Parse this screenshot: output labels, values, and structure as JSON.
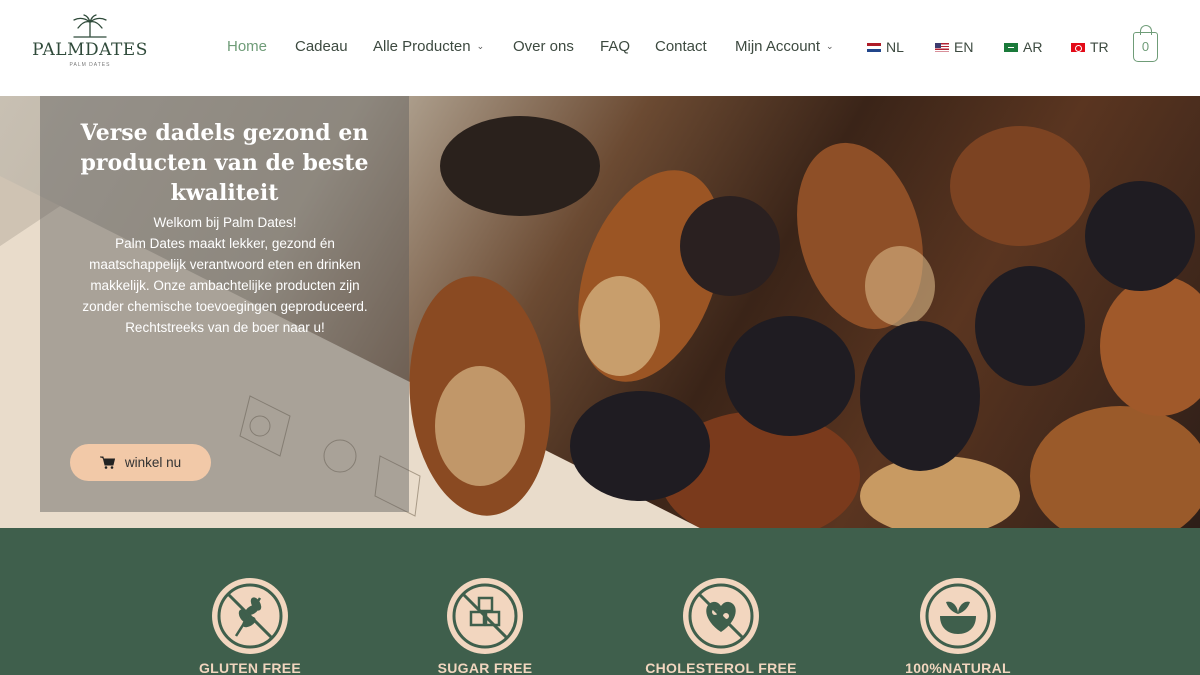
{
  "header": {
    "logo": {
      "name": "PALMDATES",
      "tagline": "PALM DATES"
    },
    "nav": [
      {
        "label": "Home",
        "active": true
      },
      {
        "label": "Cadeau"
      },
      {
        "label": "Alle Producten",
        "has_dropdown": true
      },
      {
        "label": "Over ons"
      },
      {
        "label": "FAQ"
      },
      {
        "label": "Contact"
      },
      {
        "label": "Mijn Account",
        "has_dropdown": true
      }
    ],
    "languages": [
      {
        "code": "NL",
        "flag": "netherlands-flag"
      },
      {
        "code": "EN",
        "flag": "usa-flag"
      },
      {
        "code": "AR",
        "flag": "saudi-flag"
      },
      {
        "code": "TR",
        "flag": "turkey-flag"
      }
    ],
    "cart": {
      "count": "0",
      "icon": "shopping-bag-icon"
    }
  },
  "hero": {
    "title": "Verse dadels gezond en producten van de beste kwaliteit",
    "intro": "Welkom bij Palm Dates!",
    "text": "Palm Dates maakt lekker, gezond én maatschappelijk verantwoord eten en drinken makkelijk. Onze ambachtelijke producten zijn zonder chemische toevoegingen geproduceerd. Rechtstreeks van de boer naar u!",
    "button_label": "winkel nu",
    "button_icon": "cart-icon"
  },
  "features": [
    {
      "label": "GLUTEN FREE",
      "icon": "gluten-free-icon"
    },
    {
      "label": "SUGAR FREE",
      "icon": "sugar-free-icon"
    },
    {
      "label": "CHOLESTEROL FREE",
      "icon": "cholesterol-free-icon"
    },
    {
      "label": "100%NATURAL",
      "icon": "natural-bowl-icon"
    }
  ],
  "colors": {
    "brand_green": "#3f5f4c",
    "nav_active": "#6f9c78",
    "button_peach": "#f2c9a8",
    "feature_label": "#f2d6bf"
  }
}
